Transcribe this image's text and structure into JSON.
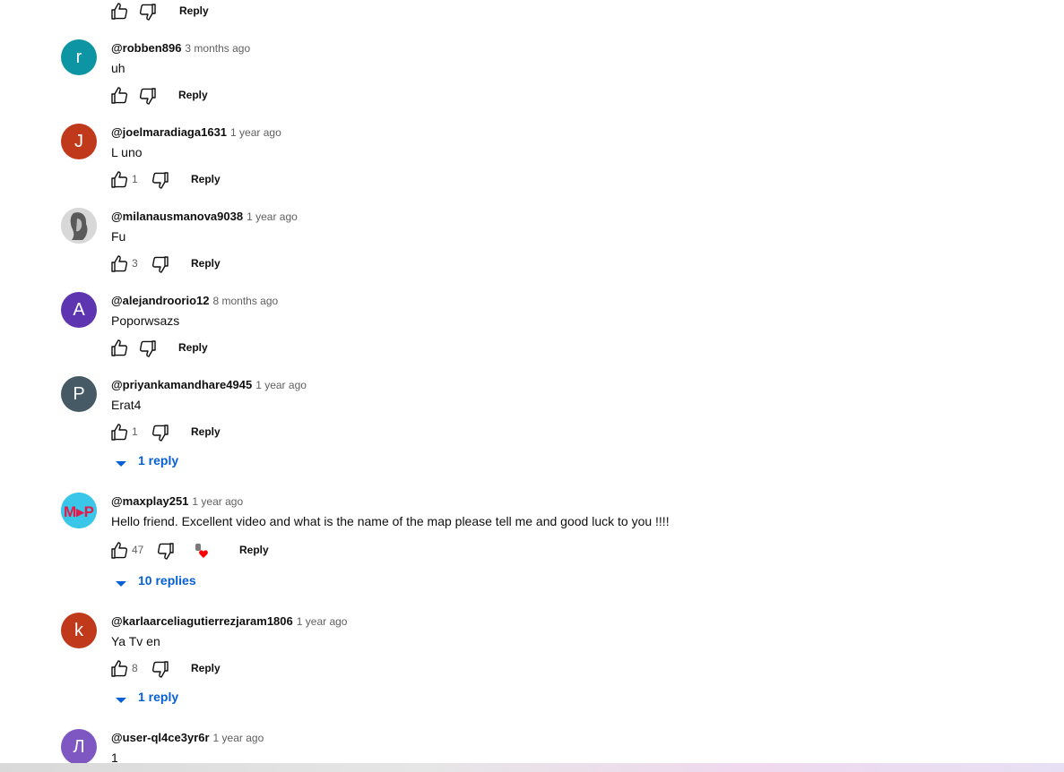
{
  "labels": {
    "reply": "Reply"
  },
  "top_actions": {
    "reply": "Reply"
  },
  "comments": [
    {
      "avatar_letter": "r",
      "avatar_color": "#0e95a4",
      "handle": "@robben896",
      "time": "3 months ago",
      "text": "uh",
      "likes": "",
      "reply": "Reply"
    },
    {
      "avatar_letter": "J",
      "avatar_color": "#c0391b",
      "handle": "@joelmaradiaga1631",
      "time": "1 year ago",
      "text": "L uno",
      "likes": "1",
      "reply": "Reply"
    },
    {
      "avatar_letter": "",
      "avatar_color": "#cfcfcf",
      "handle": "@milanausmanova9038",
      "time": "1 year ago",
      "text": "Fu",
      "likes": "3",
      "reply": "Reply"
    },
    {
      "avatar_letter": "A",
      "avatar_color": "#5e35b1",
      "handle": "@alejandroorio12",
      "time": "8 months ago",
      "text": "Poporwsazs",
      "likes": "",
      "reply": "Reply"
    },
    {
      "avatar_letter": "P",
      "avatar_color": "#455a64",
      "handle": "@priyankamandhare4945",
      "time": "1 year ago",
      "text": "Erat4",
      "likes": "1",
      "reply": "Reply",
      "replies": "1 reply"
    },
    {
      "avatar_letter": "MP",
      "avatar_color": "#39c6e8",
      "handle": "@maxplay251",
      "time": "1 year ago",
      "text": "Hello friend. Excellent video and what is the name of the map please tell me and good luck to you !!!!",
      "likes": "47",
      "reply": "Reply",
      "replies": "10 replies"
    },
    {
      "avatar_letter": "k",
      "avatar_color": "#c0391b",
      "handle": "@karlaarceliagutierrezjaram1806",
      "time": "1 year ago",
      "text": "Ya Tv en",
      "likes": "8",
      "reply": "Reply",
      "replies": "1 reply"
    },
    {
      "avatar_letter": "Л",
      "avatar_color": "#7e57c2",
      "handle": "@user-ql4ce3yr6r",
      "time": "1 year ago",
      "text": "1",
      "likes": "",
      "reply": ""
    }
  ],
  "icons": {
    "like": "thumb-up-icon",
    "dislike": "thumb-down-icon",
    "expand": "caret-down-icon",
    "heart": "creator-heart-icon"
  },
  "colors": {
    "link": "#065fd4",
    "muted": "#606060"
  }
}
